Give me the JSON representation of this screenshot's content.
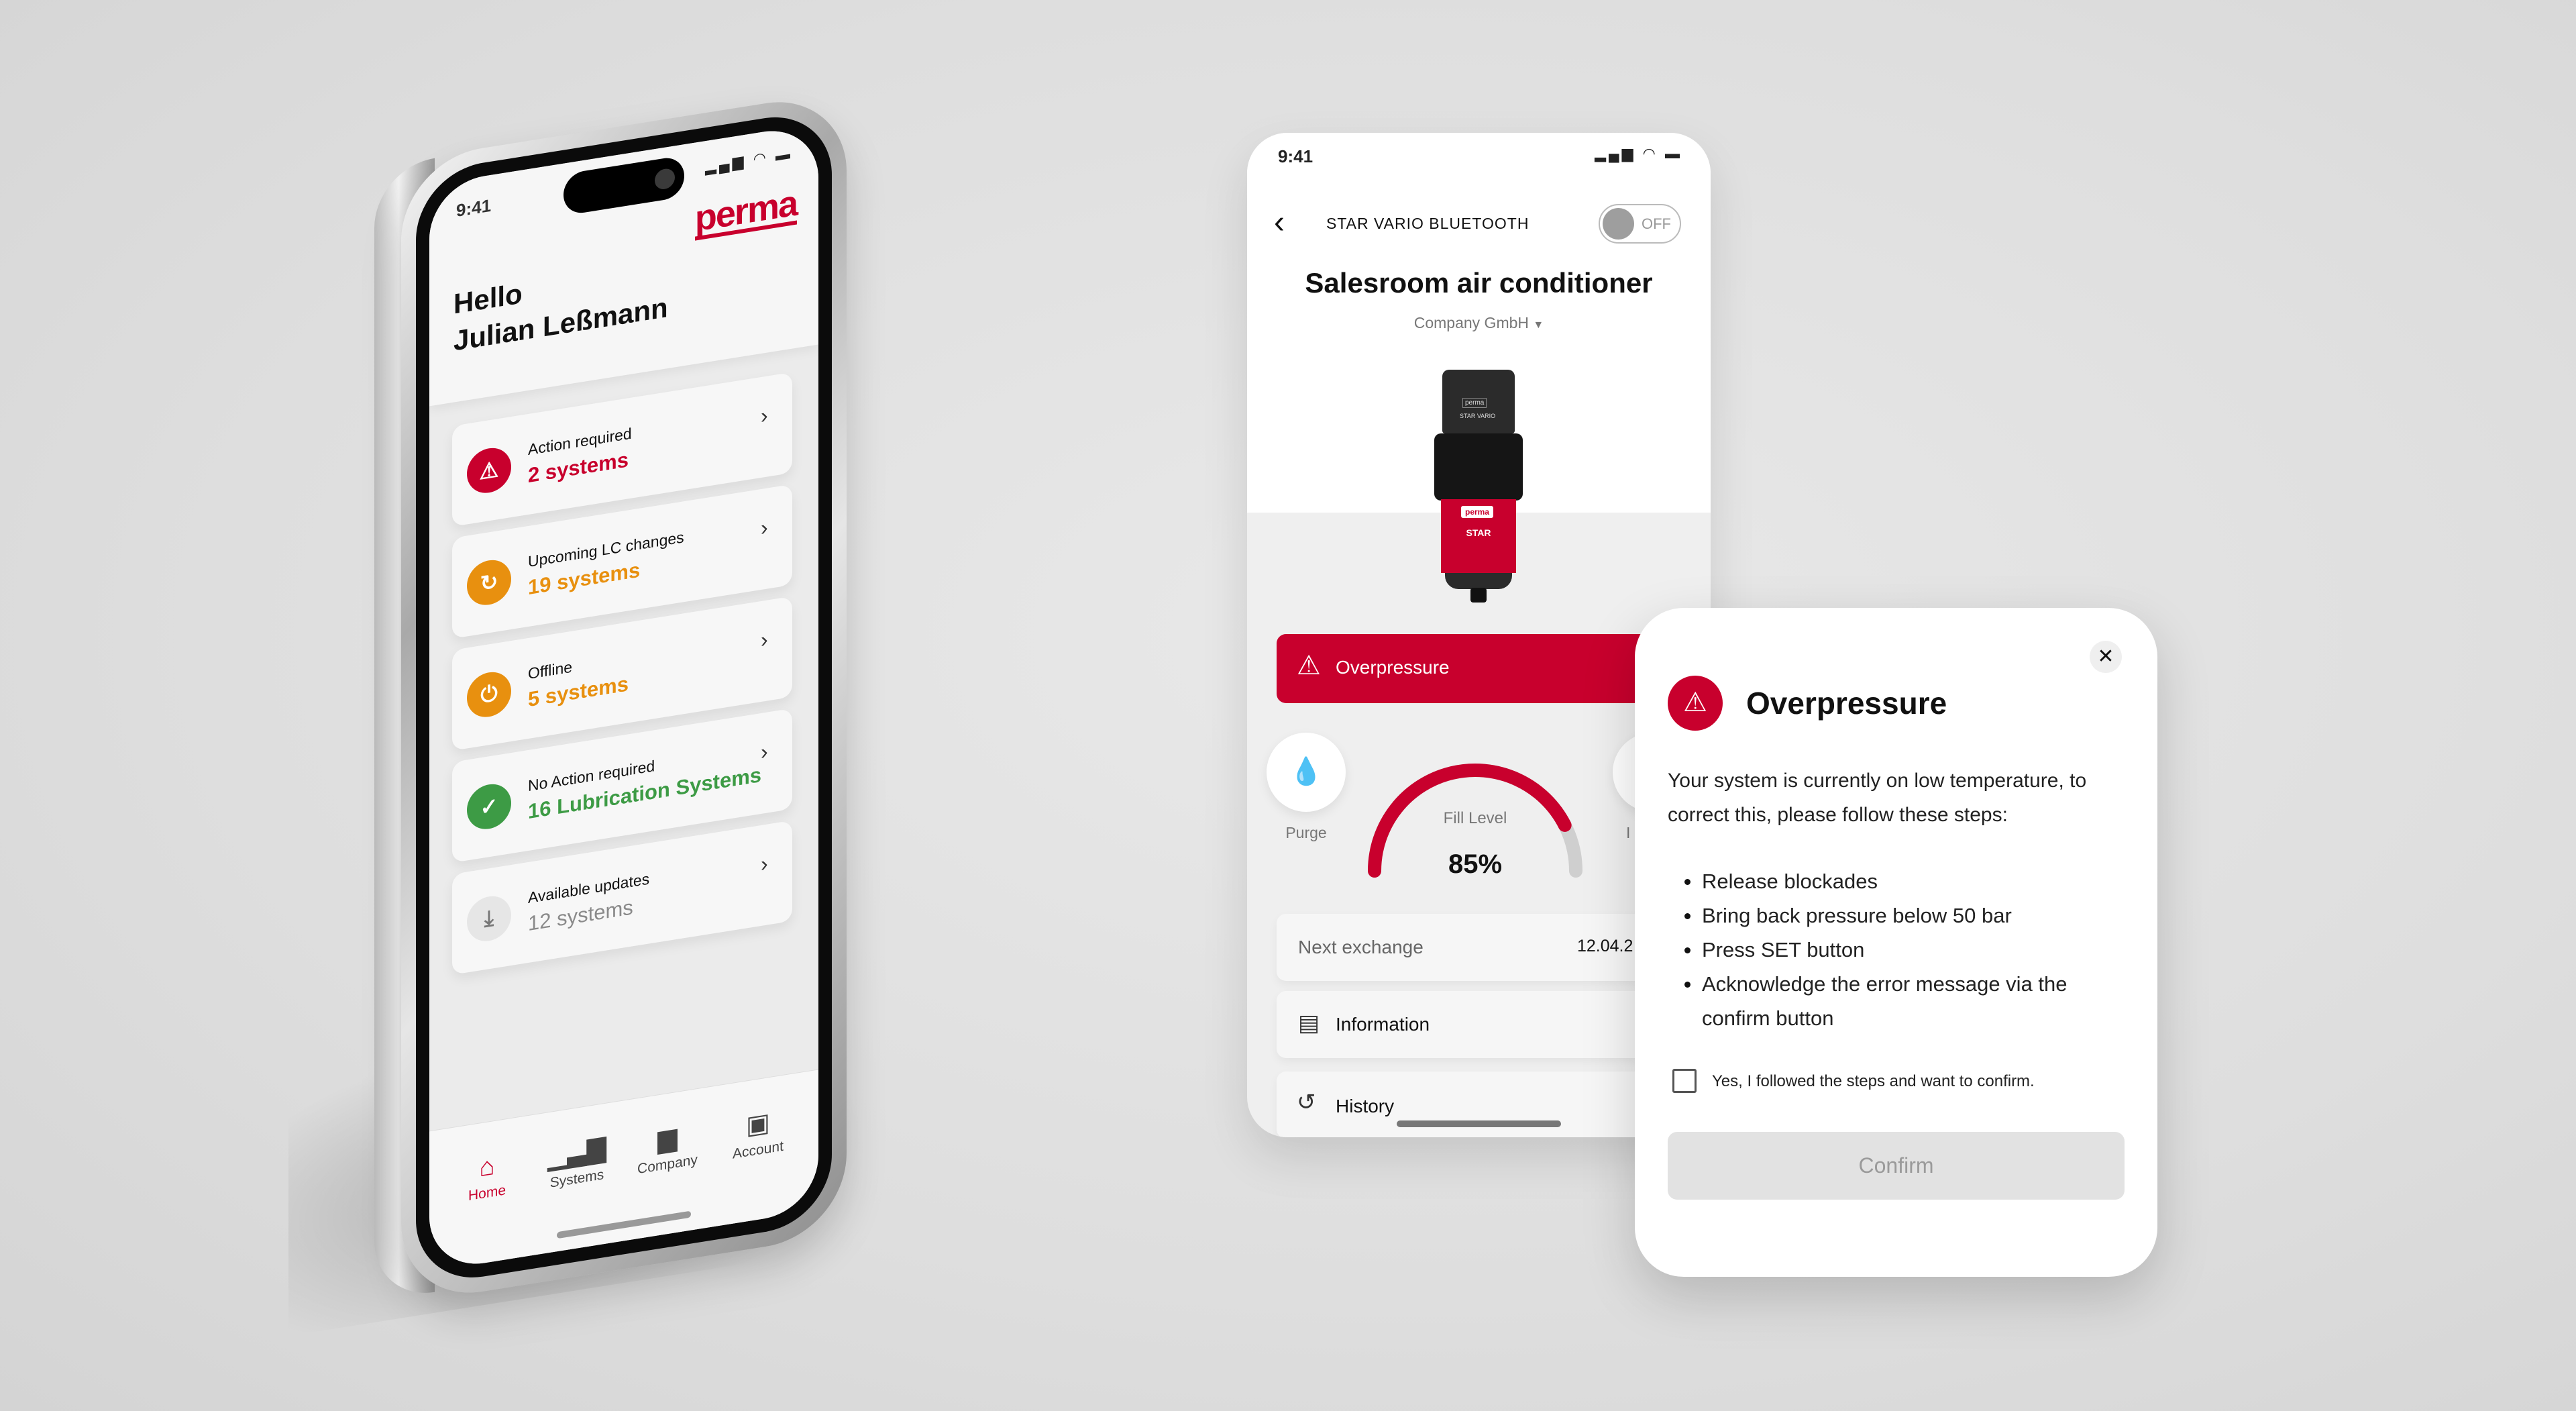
{
  "colors": {
    "brand_red": "#c8002d",
    "warning_orange": "#e8900f",
    "ok_green": "#3d9b45",
    "disabled_gray": "#e2e2e2"
  },
  "home_screen": {
    "status_time": "9:41",
    "logo": "perma",
    "greeting": "Hello",
    "user_name": "Julian Leßmann",
    "cards": [
      {
        "title": "Action required",
        "value": "2 systems",
        "color": "#c8002d",
        "icon": "warning-icon"
      },
      {
        "title": "Upcoming LC changes",
        "value": "19 systems",
        "color": "#e8900f",
        "icon": "refresh-icon"
      },
      {
        "title": "Offline",
        "value": "5 systems",
        "color": "#e8900f",
        "icon": "power-icon"
      },
      {
        "title": "No Action required",
        "value": "16 Lubrication Systems",
        "color": "#3d9b45",
        "icon": "check-icon"
      },
      {
        "title": "Available updates",
        "value": "12 systems",
        "color": "#8a8a8a",
        "icon": "download-icon"
      }
    ],
    "nav": [
      {
        "label": "Home",
        "icon": "home-icon",
        "active": true
      },
      {
        "label": "Systems",
        "icon": "bar-chart-icon",
        "active": false
      },
      {
        "label": "Company",
        "icon": "folder-icon",
        "active": false
      },
      {
        "label": "Account",
        "icon": "account-icon",
        "active": false
      }
    ]
  },
  "device_screen": {
    "status_time": "9:41",
    "title": "STAR VARIO BLUETOOTH",
    "bluetooth_toggle": {
      "label": "OFF",
      "on": false
    },
    "device_name": "Salesroom air conditioner",
    "company": "Company GmbH",
    "product": {
      "top_label": "perma",
      "model": "STAR VARIO",
      "cartridge_logo": "perma",
      "cartridge_label": "STAR"
    },
    "alert_banner": "Overpressure",
    "purge_label": "Purge",
    "partial_action_label": "I",
    "fill_gauge": {
      "label": "Fill Level",
      "value_text": "85%",
      "value": 85
    },
    "next_exchange": {
      "label": "Next exchange",
      "value": "12.04.2"
    },
    "menu": [
      {
        "label": "Information",
        "icon": "document-icon"
      },
      {
        "label": "History",
        "icon": "history-icon"
      }
    ]
  },
  "modal": {
    "title": "Overpressure",
    "body": "Your system is currently on low temperature, to correct this, please follow these steps:",
    "steps": [
      "Release blockades",
      "Bring back pressure below 50 bar",
      "Press SET button",
      "Acknowledge the error message via the confirm button"
    ],
    "checkbox_label": "Yes, I followed the steps and want to confirm.",
    "checkbox_checked": false,
    "confirm_label": "Confirm",
    "close_icon": "close-icon"
  }
}
